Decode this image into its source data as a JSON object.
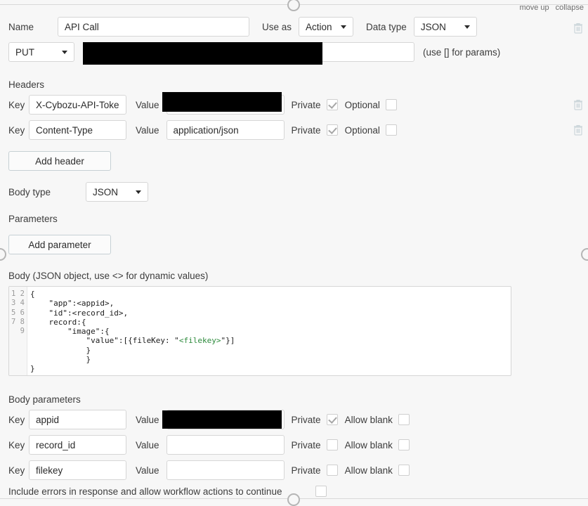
{
  "topbar": {
    "move_up": "move up",
    "collapse": "collapse"
  },
  "name_row": {
    "name_label": "Name",
    "name_value": "API Call",
    "use_as_label": "Use as",
    "use_as_value": "Action",
    "data_type_label": "Data type",
    "data_type_value": "JSON"
  },
  "url_row": {
    "method": "PUT",
    "url_value": "",
    "hint": "(use [] for params)"
  },
  "headers": {
    "title": "Headers",
    "key_label": "Key",
    "value_label": "Value",
    "private_label": "Private",
    "optional_label": "Optional",
    "rows": [
      {
        "key": "X-Cybozu-API-Token",
        "value": "",
        "private": true,
        "optional": false,
        "value_redacted": true
      },
      {
        "key": "Content-Type",
        "value": "application/json",
        "private": true,
        "optional": false,
        "value_redacted": false
      }
    ],
    "add_button": "Add header"
  },
  "body_type": {
    "label": "Body type",
    "value": "JSON"
  },
  "parameters": {
    "title": "Parameters",
    "add_button": "Add parameter"
  },
  "body": {
    "label": "Body (JSON object, use <> for dynamic values)",
    "line_numbers": [
      "1",
      "2",
      "3",
      "4",
      "5",
      "6",
      "7",
      "8",
      "9"
    ],
    "lines": [
      {
        "pre": "{",
        "green": "",
        "post": ""
      },
      {
        "pre": "    \"app\":<appid>,",
        "green": "",
        "post": ""
      },
      {
        "pre": "    \"id\":<record_id>,",
        "green": "",
        "post": ""
      },
      {
        "pre": "    record:{",
        "green": "",
        "post": ""
      },
      {
        "pre": "        \"image\":{",
        "green": "",
        "post": ""
      },
      {
        "pre": "            \"value\":[{fileKey: \"",
        "green": "<filekey>",
        "post": "\"}]"
      },
      {
        "pre": "            }",
        "green": "",
        "post": ""
      },
      {
        "pre": "            }",
        "green": "",
        "post": ""
      },
      {
        "pre": "}",
        "green": "",
        "post": ""
      }
    ]
  },
  "body_parameters": {
    "title": "Body parameters",
    "key_label": "Key",
    "value_label": "Value",
    "private_label": "Private",
    "allow_blank_label": "Allow blank",
    "rows": [
      {
        "key": "appid",
        "value": "",
        "private": true,
        "allow_blank": false,
        "value_redacted": true
      },
      {
        "key": "record_id",
        "value": "",
        "private": false,
        "allow_blank": false,
        "value_redacted": false
      },
      {
        "key": "filekey",
        "value": "",
        "private": false,
        "allow_blank": false,
        "value_redacted": false
      }
    ]
  },
  "footer": {
    "include_errors_label": "Include errors in response and allow workflow actions to continue",
    "include_errors_checked": false
  },
  "icons": {
    "trash": "trash-icon",
    "caret": "chevron-down-icon"
  },
  "colors": {
    "background": "#f7f7f7",
    "border": "#d6d6d6",
    "text": "#3c3c3c",
    "code_green": "#2e8b3d",
    "redaction": "#000000"
  }
}
